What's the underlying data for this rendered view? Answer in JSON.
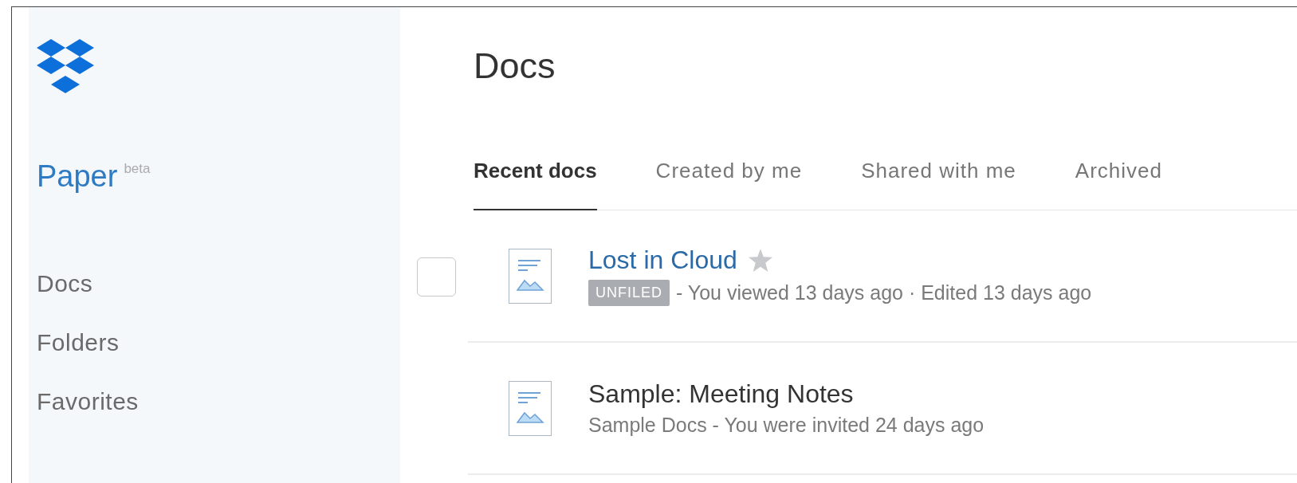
{
  "sidebar": {
    "brand": "Paper",
    "brand_badge": "beta",
    "items": [
      {
        "label": "Docs",
        "selected": false
      },
      {
        "label": "Folders",
        "selected": false
      },
      {
        "label": "Favorites",
        "selected": false
      }
    ]
  },
  "heading": "Docs",
  "tabs": [
    {
      "label": "Recent docs",
      "selected": true
    },
    {
      "label": "Created by me",
      "selected": false
    },
    {
      "label": "Shared with me",
      "selected": false
    },
    {
      "label": "Archived",
      "selected": false
    }
  ],
  "docs": [
    {
      "title": "Lost in Cloud",
      "hovered": true,
      "starred": false,
      "tag": "UNFILED",
      "meta": "- You viewed 13 days ago · Edited 13 days ago"
    },
    {
      "title": "Sample: Meeting Notes",
      "hovered": false,
      "starred": false,
      "meta": "Sample Docs - You were invited 24 days ago"
    }
  ]
}
